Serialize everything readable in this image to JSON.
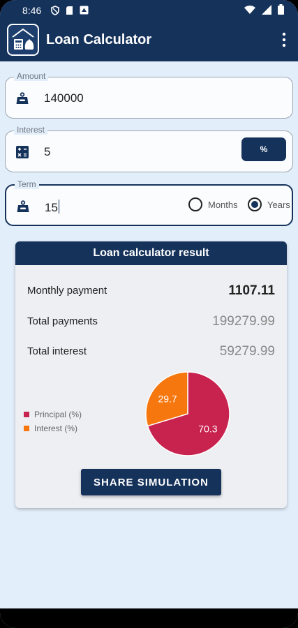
{
  "status": {
    "time": "8:46"
  },
  "appbar": {
    "title": "Loan Calculator"
  },
  "amount": {
    "label": "Amount",
    "value": "140000"
  },
  "interest": {
    "label": "Interest",
    "value": "5",
    "unit_button": "%"
  },
  "term": {
    "label": "Term",
    "value": "15",
    "options": [
      "Months",
      "Years"
    ],
    "selected": "Years"
  },
  "result": {
    "title": "Loan calculator result",
    "monthly_label": "Monthly payment",
    "monthly_value": "1107.11",
    "total_label": "Total payments",
    "total_value": "199279.99",
    "interest_label": "Total interest",
    "interest_value": "59279.99",
    "share_label": "SHARE SIMULATION"
  },
  "chart_data": {
    "type": "pie",
    "labels": [
      "Principal (%)",
      "Interest (%)"
    ],
    "values": [
      70.3,
      29.7
    ],
    "colors": [
      "#c8234f",
      "#f7770f"
    ],
    "legend": "left"
  },
  "colors": {
    "primary": "#15325b",
    "background": "#e3eefb"
  }
}
